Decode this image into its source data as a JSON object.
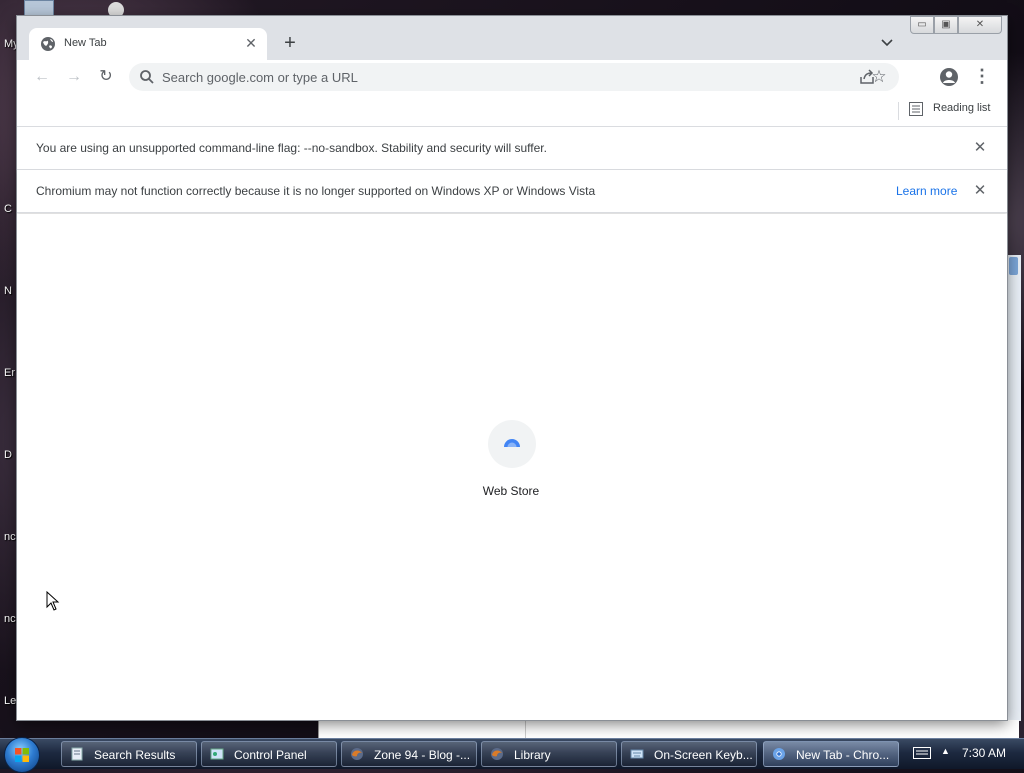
{
  "desktop": {
    "labels": [
      "My",
      "C",
      "N",
      "Er",
      "D",
      "nc",
      "nc",
      "Leg"
    ]
  },
  "browser": {
    "tab": {
      "title": "New Tab",
      "icon": "globe-icon"
    },
    "omnibox": {
      "placeholder": "Search google.com or type a URL",
      "value": ""
    },
    "reading_list": {
      "label": "Reading list"
    },
    "infobars": [
      {
        "text": "You are using an unsupported command-line flag: --no-sandbox. Stability and security will suffer."
      },
      {
        "text": "Chromium may not function correctly because it is no longer supported on Windows XP or Windows Vista",
        "link": "Learn more"
      }
    ],
    "shortcuts": [
      {
        "label": "Web Store",
        "icon": "chrome-web-store-icon"
      }
    ]
  },
  "taskbar": {
    "tasks": [
      {
        "label": "Search Results",
        "icon": "search-results-icon",
        "active": false
      },
      {
        "label": "Control Panel",
        "icon": "control-panel-icon",
        "active": false
      },
      {
        "label": "Zone 94 - Blog -...",
        "icon": "firefox-icon",
        "active": false
      },
      {
        "label": "Library",
        "icon": "firefox-icon",
        "active": false
      },
      {
        "label": "On-Screen Keyb...",
        "icon": "keyboard-icon",
        "active": false
      },
      {
        "label": "New Tab - Chro...",
        "icon": "chromium-icon",
        "active": true
      }
    ],
    "clock": "7:30 AM"
  },
  "colors": {
    "accent": "#1a73e8",
    "titlebar": "#dee1e6",
    "omnibox": "#f1f3f4"
  }
}
